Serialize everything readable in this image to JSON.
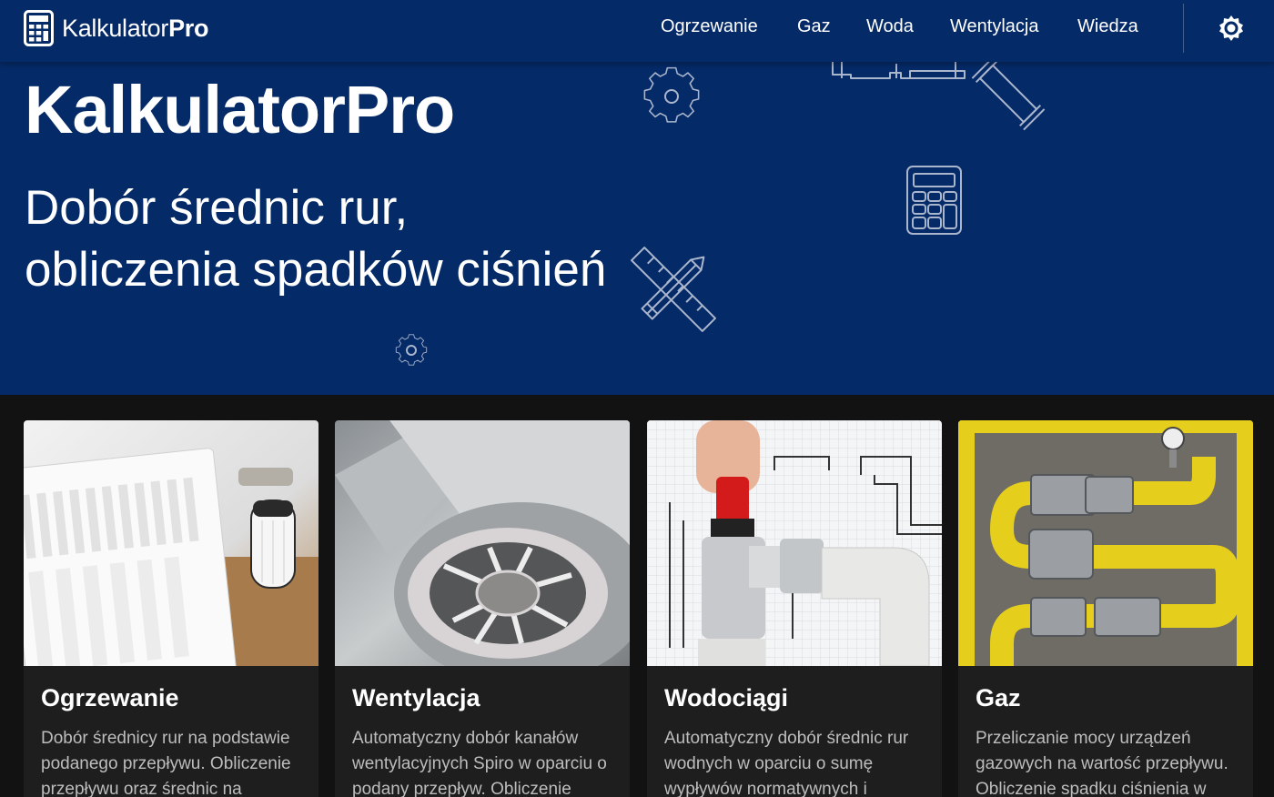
{
  "header": {
    "brand_light": "Kalkulator",
    "brand_bold": "Pro",
    "nav": [
      "Ogrzewanie",
      "Gaz",
      "Woda",
      "Wentylacja",
      "Wiedza"
    ]
  },
  "hero": {
    "title": "KalkulatorPro",
    "subtitle_line1": "Dobór średnic rur,",
    "subtitle_line2": "obliczenia spadków ciśnień"
  },
  "cards": [
    {
      "title": "Ogrzewanie",
      "text": "Dobór średnicy rur na podstawie podanego przepływu. Obliczenie przepływu oraz średnic na"
    },
    {
      "title": "Wentylacja",
      "text": "Automatyczny dobór kanałów wentylacyjnych Spiro w oparciu o podany przepływ. Obliczenie"
    },
    {
      "title": "Wodociągi",
      "text": "Automatyczny dobór średnic rur wodnych w oparciu o sumę wypływów normatywnych i"
    },
    {
      "title": "Gaz",
      "text": "Przeliczanie mocy urządzeń gazowych na wartość przepływu. Obliczenie spadku ciśnienia w"
    }
  ],
  "colors": {
    "brand_blue": "#052a68",
    "page_bg": "#121212",
    "card_bg": "#1e1e1e",
    "pipe_yellow": "#e5cf1c"
  },
  "icons": [
    "calculator-icon",
    "brightness-icon",
    "gear-icon",
    "pipe-icon",
    "pencil-ruler-icon"
  ]
}
